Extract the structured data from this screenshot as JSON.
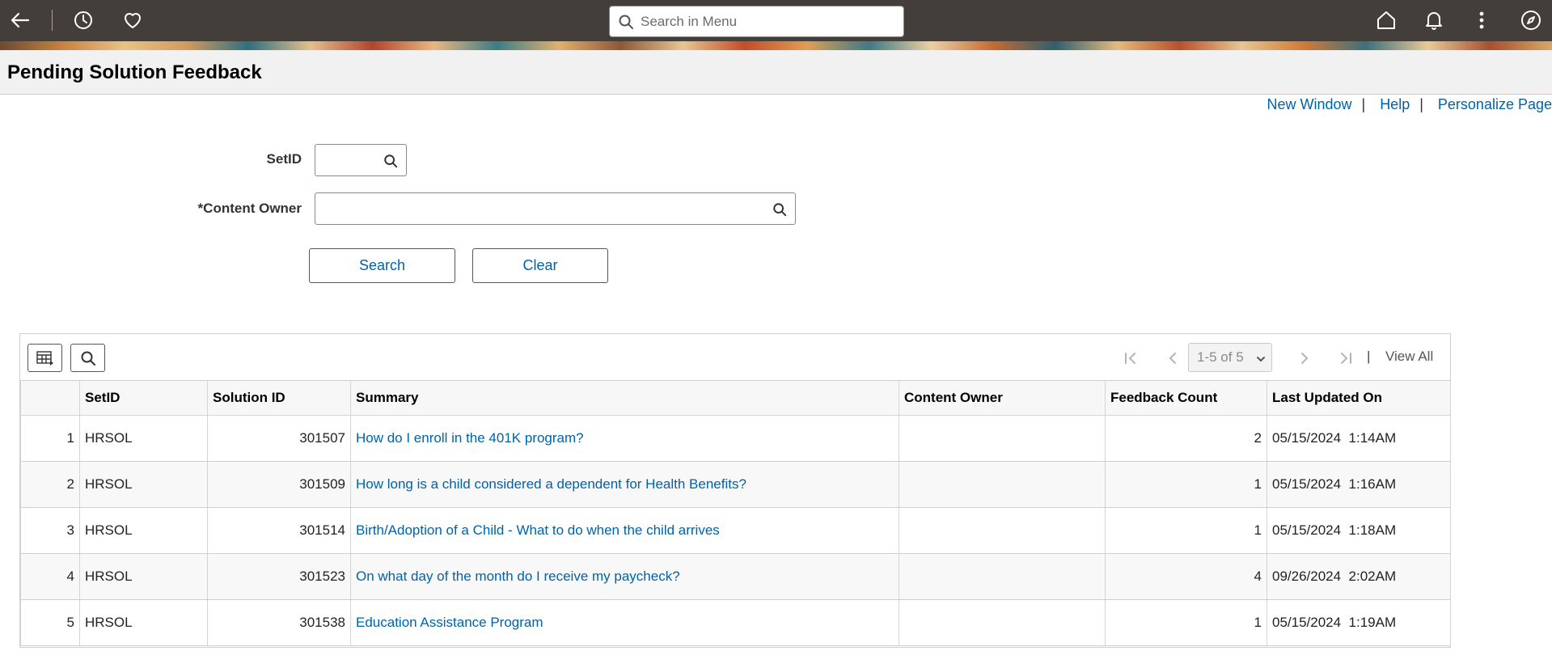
{
  "header": {
    "search_placeholder": "Search in Menu",
    "icons": [
      "back-arrow-icon",
      "history-icon",
      "favorites-heart-icon",
      "home-icon",
      "notifications-bell-icon",
      "actions-menu-icon",
      "navbar-compass-icon"
    ]
  },
  "page": {
    "title": "Pending Solution Feedback"
  },
  "links": {
    "new_window": "New Window",
    "help": "Help",
    "personalize": "Personalize Page",
    "separator": "|"
  },
  "form": {
    "setid_label": "SetID",
    "setid_value": "",
    "content_owner_label": "*Content Owner",
    "content_owner_value": "",
    "search_button": "Search",
    "clear_button": "Clear"
  },
  "grid": {
    "pager_text": "1-5 of 5",
    "pager_separator": "|",
    "view_all": "View All",
    "columns": [
      "",
      "SetID",
      "Solution ID",
      "Summary",
      "Content Owner",
      "Feedback Count",
      "Last Updated On"
    ],
    "rows": [
      {
        "num": "1",
        "setid": "HRSOL",
        "solution_id": "301507",
        "summary": "How do I enroll in the 401K program?",
        "content_owner": "",
        "feedback_count": "2",
        "last_updated": "05/15/2024  1:14AM"
      },
      {
        "num": "2",
        "setid": "HRSOL",
        "solution_id": "301509",
        "summary": "How long is a child considered a dependent for Health Benefits?",
        "content_owner": "",
        "feedback_count": "1",
        "last_updated": "05/15/2024  1:16AM"
      },
      {
        "num": "3",
        "setid": "HRSOL",
        "solution_id": "301514",
        "summary": "Birth/Adoption of a Child - What to do when the child arrives",
        "content_owner": "",
        "feedback_count": "1",
        "last_updated": "05/15/2024  1:18AM"
      },
      {
        "num": "4",
        "setid": "HRSOL",
        "solution_id": "301523",
        "summary": "On what day of the month do I receive my paycheck?",
        "content_owner": "",
        "feedback_count": "4",
        "last_updated": "09/26/2024  2:02AM"
      },
      {
        "num": "5",
        "setid": "HRSOL",
        "solution_id": "301538",
        "summary": "Education Assistance Program",
        "content_owner": "",
        "feedback_count": "1",
        "last_updated": "05/15/2024  1:19AM"
      }
    ]
  },
  "colors": {
    "header_bg": "#433e39",
    "link": "#0062a8",
    "title_bar_bg": "#f1f1f1"
  }
}
